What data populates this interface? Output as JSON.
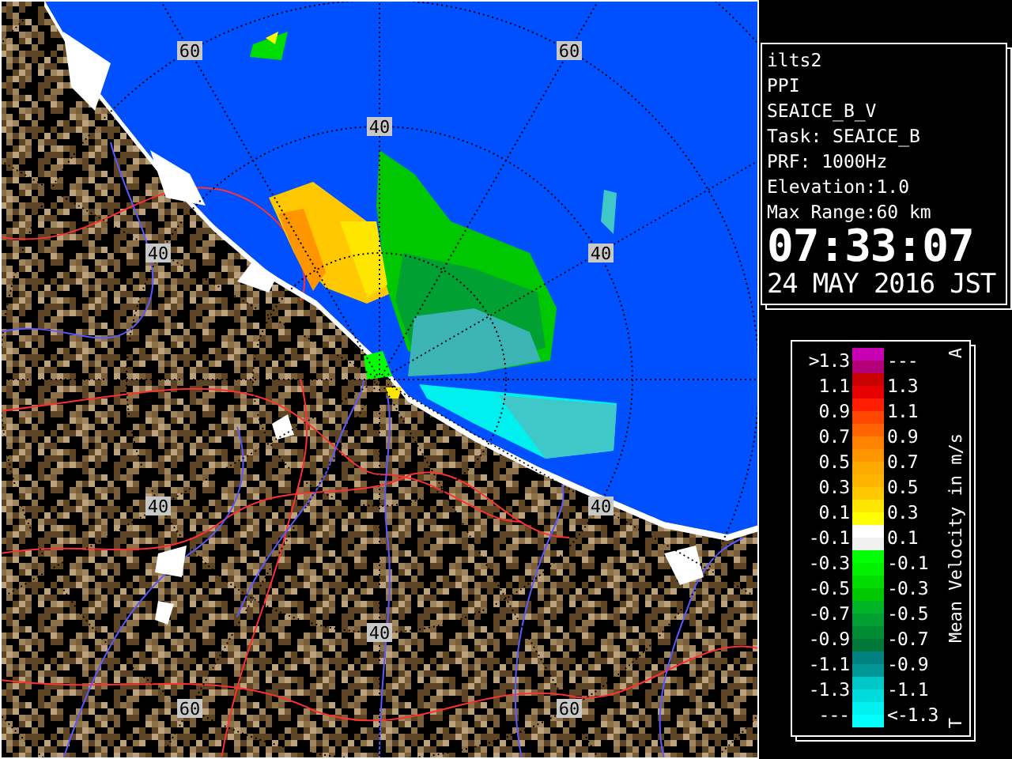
{
  "map": {
    "range_labels": [
      "60",
      "60",
      "40",
      "40",
      "40",
      "40",
      "40",
      "40",
      "60",
      "60"
    ]
  },
  "info": {
    "station": "ilts2",
    "scan_type": "PPI",
    "product": "SEAICE_B_V",
    "task": "Task: SEAICE_B",
    "prf": "PRF: 1000Hz",
    "elevation": "Elevation:1.0",
    "max_range": "Max Range:60 km",
    "time": "07:33:07",
    "date": "24 MAY 2016 JST"
  },
  "legend": {
    "title": "Mean Velocity in m/s",
    "top_mark": "A",
    "bottom_mark": "T",
    "left_labels": [
      ">1.3",
      "1.1",
      "0.9",
      "0.7",
      "0.5",
      "0.3",
      "0.1",
      "-0.1",
      "-0.3",
      "-0.5",
      "-0.7",
      "-0.9",
      "-1.1",
      "-1.3",
      "---"
    ],
    "right_labels": [
      "---",
      "1.3",
      "1.1",
      "0.9",
      "0.7",
      "0.5",
      "0.3",
      "0.1",
      "-0.1",
      "-0.3",
      "-0.5",
      "-0.7",
      "-0.9",
      "-1.1",
      "<-1.3"
    ],
    "swatches": [
      {
        "color": "#c800b4"
      },
      {
        "color": "#b40078"
      },
      {
        "color": "#c80000"
      },
      {
        "color": "#e60000"
      },
      {
        "color": "#ff1e00"
      },
      {
        "color": "#ff4600"
      },
      {
        "color": "#ff6400"
      },
      {
        "color": "#ff8200"
      },
      {
        "color": "#ff9600"
      },
      {
        "color": "#ffaa00"
      },
      {
        "color": "#ffb400"
      },
      {
        "color": "#ffc800"
      },
      {
        "color": "#ffe600"
      },
      {
        "color": "#ffff00"
      },
      {
        "color": "#ffffff"
      },
      {
        "color": "#f0f0f0"
      },
      {
        "color": "#00ff00"
      },
      {
        "color": "#00f000"
      },
      {
        "color": "#00dc00"
      },
      {
        "color": "#00c800"
      },
      {
        "color": "#00b428"
      },
      {
        "color": "#00a032"
      },
      {
        "color": "#008c32"
      },
      {
        "color": "#007838"
      },
      {
        "color": "#008080"
      },
      {
        "color": "#009696"
      },
      {
        "color": "#00c8c8"
      },
      {
        "color": "#00dcdc"
      },
      {
        "color": "#00f0f0"
      },
      {
        "color": "#00ffff"
      }
    ]
  }
}
